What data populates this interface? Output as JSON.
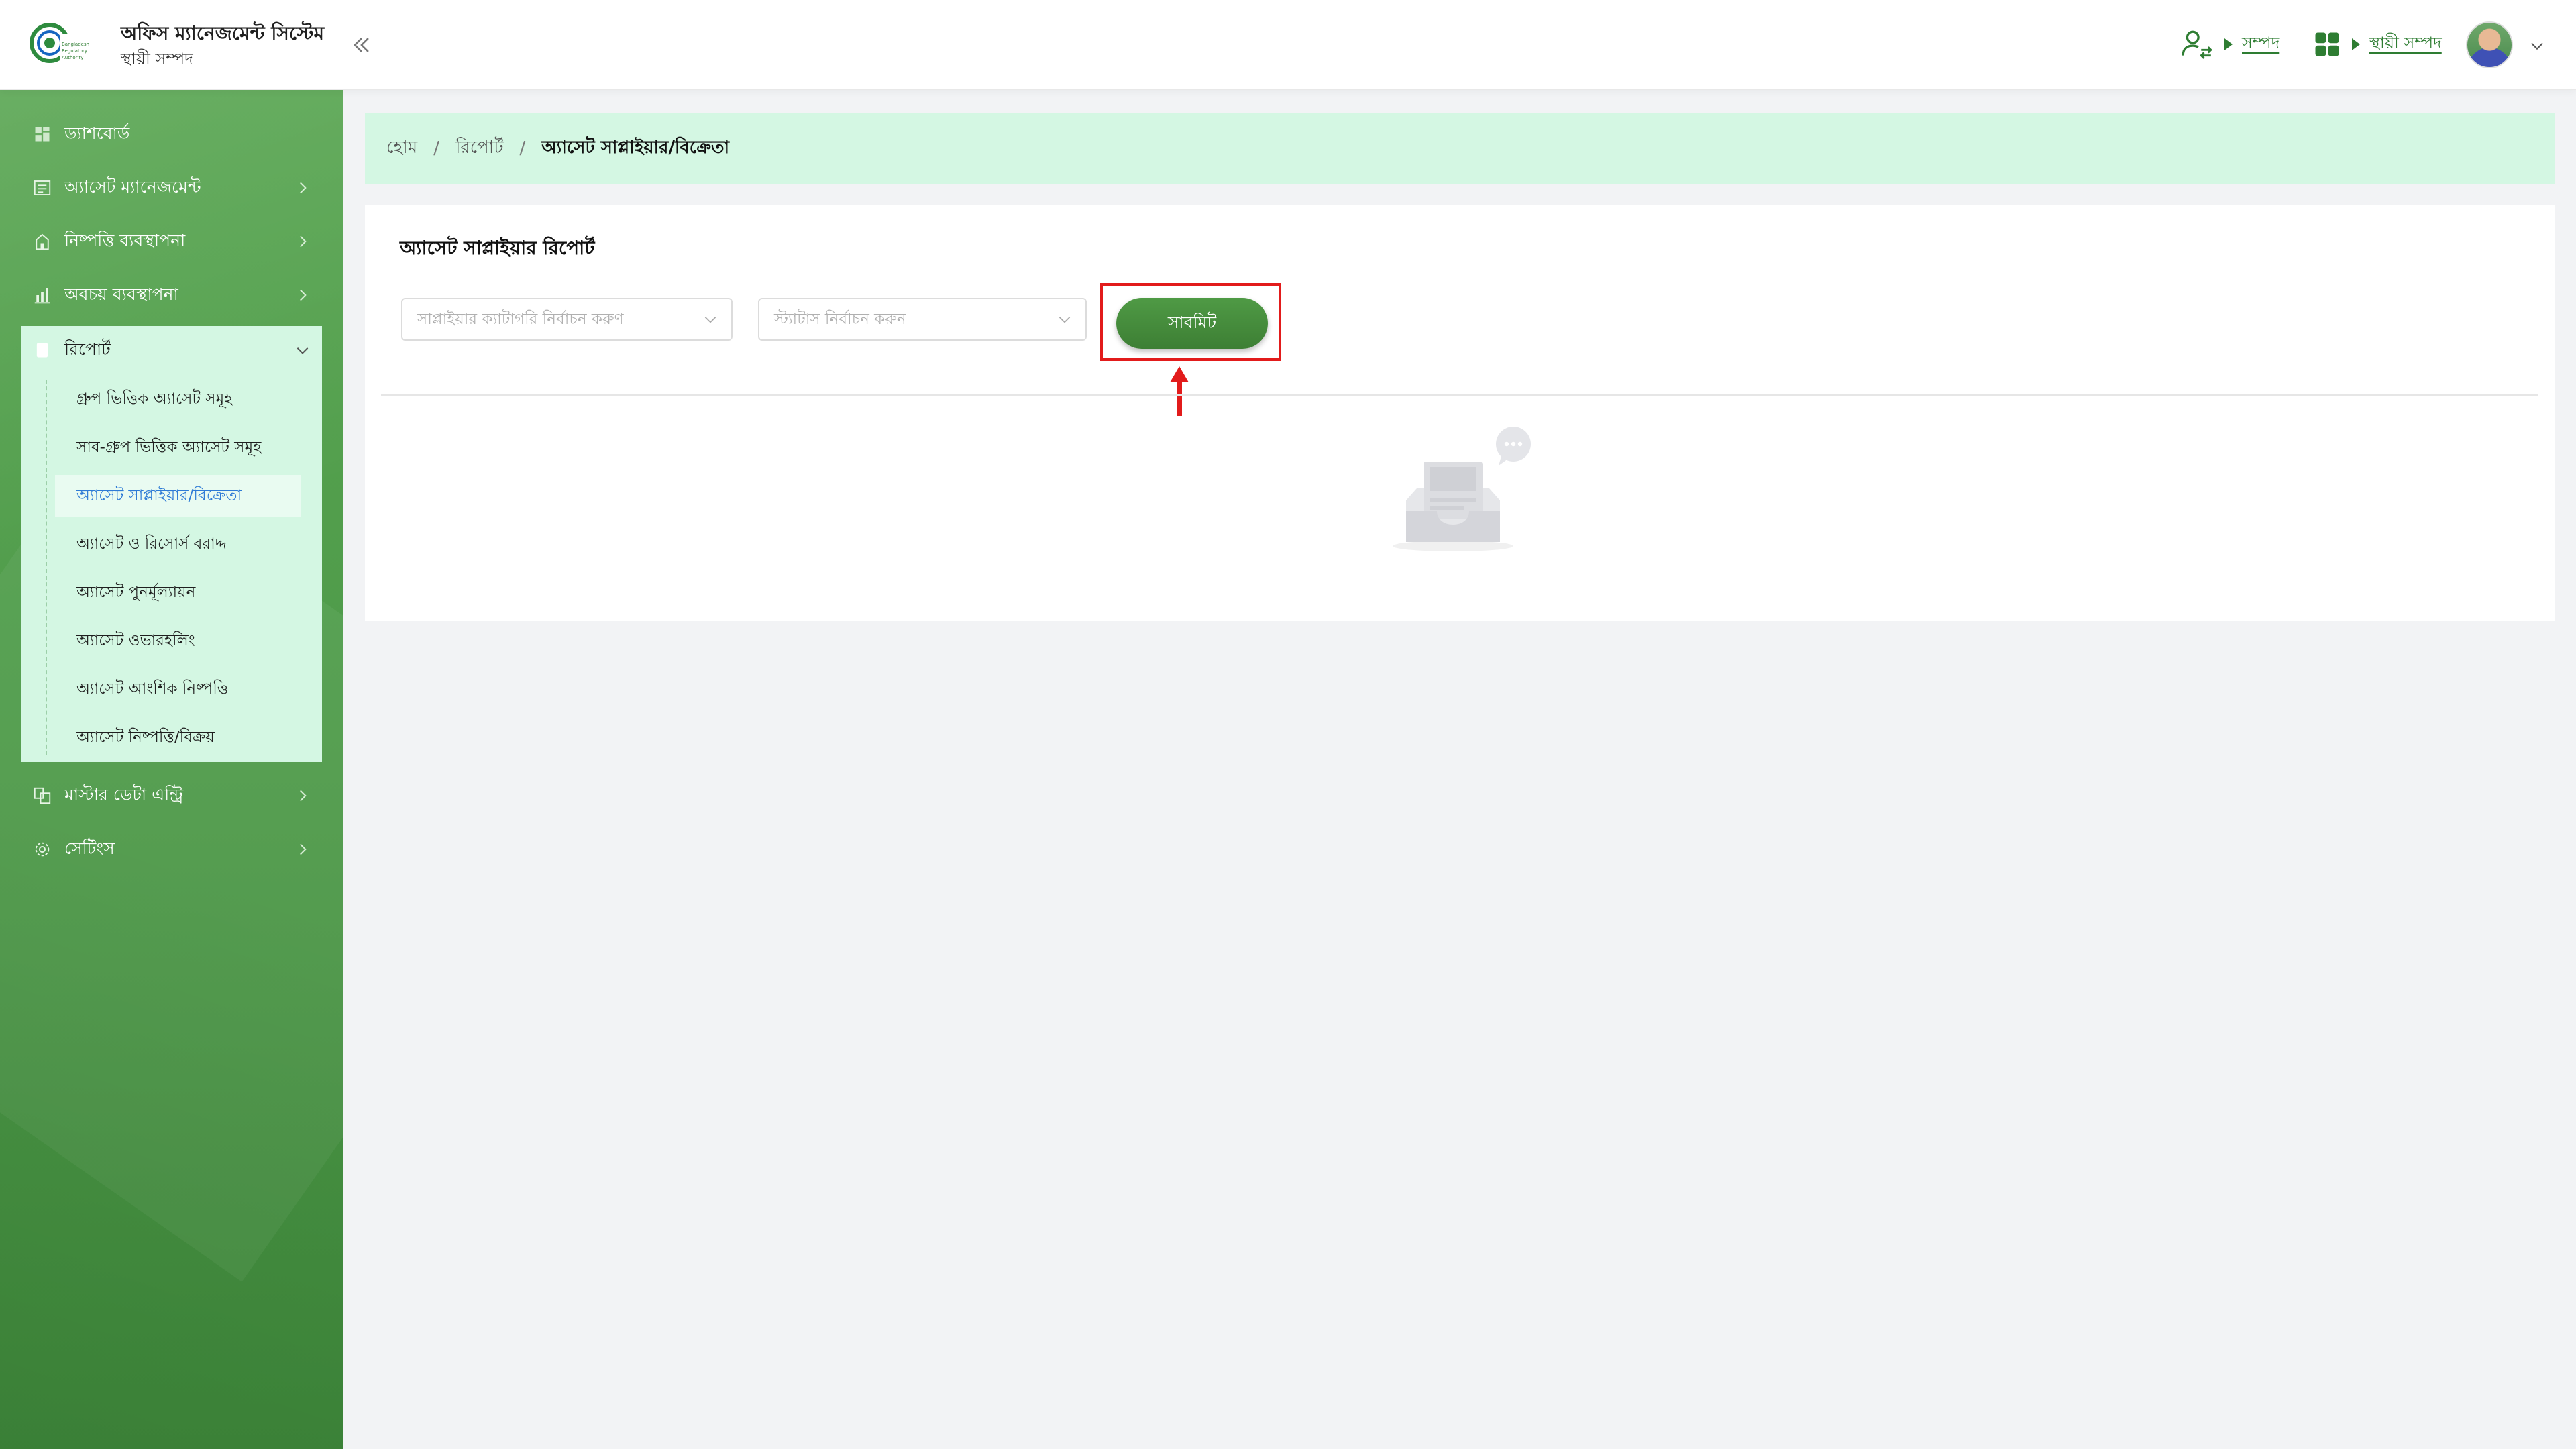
{
  "header": {
    "logo_text": "Bangladesh Regulatory Authority",
    "app_title": "অফিস ম্যানেজমেন্ট সিস্টেম",
    "app_subtitle": "স্থায়ী সম্পদ",
    "link_assets": "সম্পদ",
    "link_fixed_assets": "স্থায়ী সম্পদ",
    "icons": [
      "user-switch-icon",
      "apps-grid-icon",
      "double-chevron-left-icon",
      "chevron-down-icon"
    ]
  },
  "sidebar": {
    "items": [
      {
        "label": "ড্যাশবোর্ড",
        "icon": "dashboard-icon"
      },
      {
        "label": "অ্যাসেট ম্যানেজমেন্ট",
        "icon": "asset-icon"
      },
      {
        "label": "নিষ্পত্তি ব্যবস্থাপনা",
        "icon": "disposal-icon"
      },
      {
        "label": "অবচয় ব্যবস্থাপনা",
        "icon": "depreciation-icon"
      },
      {
        "label": "রিপোর্ট",
        "icon": "report-icon"
      },
      {
        "label": "মাস্টার ডেটা এন্ট্রি",
        "icon": "master-data-icon"
      },
      {
        "label": "সেটিংস",
        "icon": "settings-icon"
      }
    ],
    "report_sub_items": [
      "গ্রুপ ভিত্তিক অ্যাসেট সমূহ",
      "সাব-গ্রুপ ভিত্তিক অ্যাসেট সমূহ",
      "অ্যাসেট সাপ্লাইয়ার/বিক্রেতা",
      "অ্যাসেট ও রিসোর্স বরাদ্দ",
      "অ্যাসেট পুনর্মূল্যায়ন",
      "অ্যাসেট ওভারহলিং",
      "অ্যাসেট আংশিক নিষ্পত্তি",
      "অ্যাসেট নিষ্পত্তি/বিক্রয়"
    ],
    "active_sub_index": 2
  },
  "breadcrumb": {
    "home": "হোম",
    "report": "রিপোর্ট",
    "current": "অ্যাসেট সাপ্লাইয়ার/বিক্রেতা"
  },
  "report": {
    "title": "অ্যাসেট সাপ্লাইয়ার রিপোর্ট",
    "supplier_category_placeholder": "সাপ্লাইয়ার ক্যাটাগরি নির্বাচন করুণ",
    "status_placeholder": "স্ট্যাটাস নির্বাচন করুন",
    "submit_label": "সাবমিট"
  },
  "colors": {
    "brand_green": "#4e9a49",
    "light_green": "#d4f7e3",
    "active_link": "#2e7bd6",
    "highlight": "#e21b1b"
  }
}
